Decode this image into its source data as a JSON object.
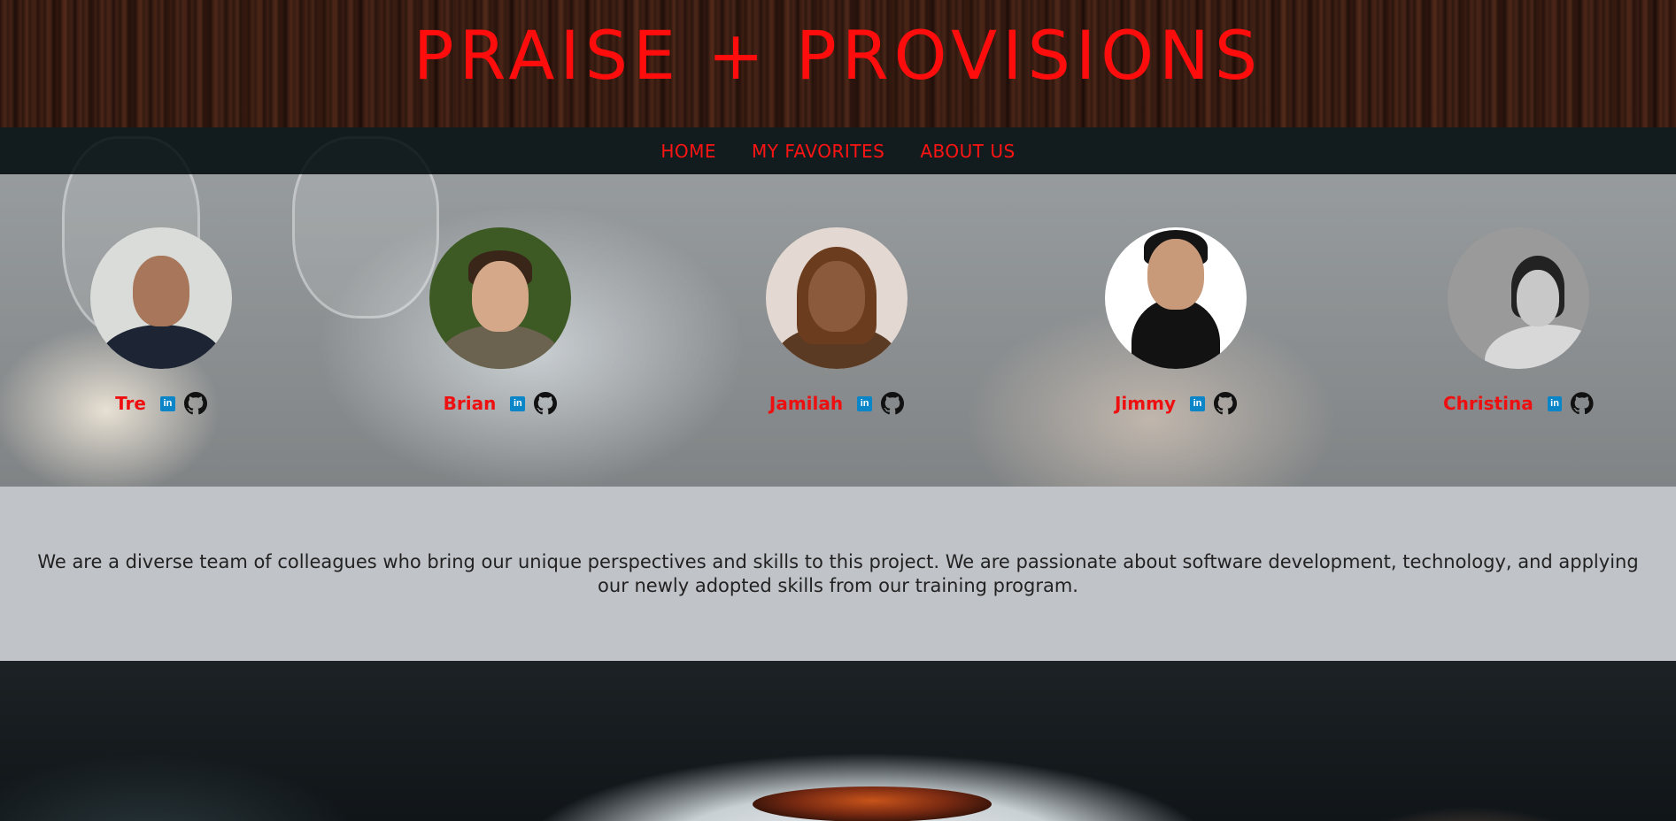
{
  "site": {
    "title": "PRAISE + PROVISIONS",
    "accent_color": "#ff0d0d"
  },
  "nav": {
    "items": [
      {
        "label": "HOME"
      },
      {
        "label": "MY FAVORITES"
      },
      {
        "label": "ABOUT US"
      }
    ]
  },
  "team": {
    "members": [
      {
        "name": "Tre",
        "linkedin_icon": "linkedin-icon",
        "github_icon": "github-icon"
      },
      {
        "name": "Brian",
        "linkedin_icon": "linkedin-icon",
        "github_icon": "github-icon"
      },
      {
        "name": "Jamilah",
        "linkedin_icon": "linkedin-icon",
        "github_icon": "github-icon"
      },
      {
        "name": "Jimmy",
        "linkedin_icon": "linkedin-icon",
        "github_icon": "github-icon"
      },
      {
        "name": "Christina",
        "linkedin_icon": "linkedin-icon",
        "github_icon": "github-icon"
      }
    ],
    "linkedin_glyph": "in"
  },
  "about": {
    "text": "We are a diverse team of colleagues who bring our unique perspectives and skills to this project. We are passionate about software development, technology, and applying our newly adopted skills from our training program."
  }
}
